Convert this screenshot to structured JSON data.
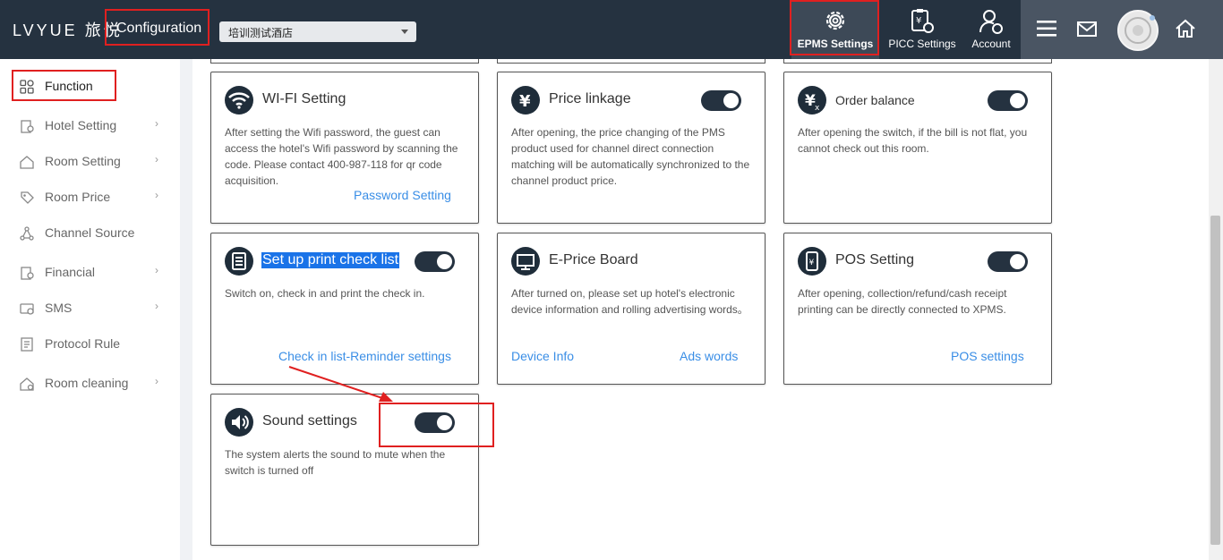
{
  "header": {
    "logo_text": "LVYUE 旅悦",
    "title": "Configuration",
    "hotel_select_value": "培训测试酒店",
    "buttons": {
      "epms": "EPMS Settings",
      "picc": "PICC Settings",
      "account": "Account"
    },
    "icons": [
      "menu-icon",
      "mail-icon",
      "avatar",
      "home-icon"
    ]
  },
  "sidebar": {
    "items": [
      {
        "label": "Function",
        "icon": "grid-icon",
        "chevron": ""
      },
      {
        "label": "Hotel Setting",
        "icon": "hotel-icon",
        "chevron": "›"
      },
      {
        "label": "Room Setting",
        "icon": "room-icon",
        "chevron": "›"
      },
      {
        "label": "Room Price",
        "icon": "price-tag-icon",
        "chevron": "›"
      },
      {
        "label": "Channel Source",
        "icon": "channel-icon",
        "chevron": ""
      },
      {
        "label": "Financial",
        "icon": "financial-icon",
        "chevron": "›"
      },
      {
        "label": "SMS",
        "icon": "sms-icon",
        "chevron": "›"
      },
      {
        "label": "Protocol Rule",
        "icon": "protocol-icon",
        "chevron": ""
      },
      {
        "label": "Room cleaning",
        "icon": "cleaning-icon",
        "chevron": "›"
      }
    ]
  },
  "cards": {
    "wifi": {
      "title": "WI-FI Setting",
      "desc": "After setting the Wifi password, the guest can access the hotel's Wifi password by scanning the code. Please contact 400-987-118 for qr code acquisition.",
      "link": "Password Setting",
      "toggle": false
    },
    "price_linkage": {
      "title": "Price linkage",
      "desc": "After opening, the price changing of the PMS product used for channel direct connection matching will be automatically synchronized to the channel product price.",
      "toggle": true
    },
    "order_balance": {
      "title": "Order balance",
      "desc": "After opening the switch, if the bill is not flat, you cannot check out this room.",
      "toggle": true
    },
    "print_check": {
      "title": "Set up print check list",
      "desc": "Switch on, check in and print the check in.",
      "link": "Check in list-Reminder settings",
      "toggle": true
    },
    "eprice": {
      "title": "E-Price Board",
      "desc": "After turned on, please set up hotel's electronic device information and rolling advertising words。",
      "link1": "Device Info",
      "link2": "Ads words",
      "toggle": false
    },
    "pos": {
      "title": "POS Setting",
      "desc": "After opening, collection/refund/cash receipt printing can be directly connected to XPMS.",
      "link": "POS settings",
      "toggle": true
    },
    "sound": {
      "title": "Sound settings",
      "desc": "The system alerts the sound to mute when the switch is turned off",
      "toggle": true
    }
  },
  "colors": {
    "topbar": "#253240",
    "accent_link": "#3a8ee6",
    "highlight_box": "#e02020"
  }
}
